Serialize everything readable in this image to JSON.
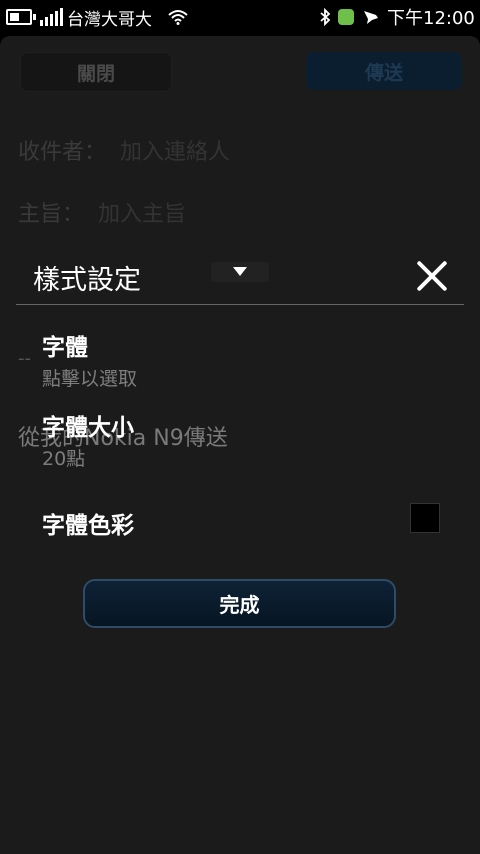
{
  "status_bar": {
    "carrier": "台灣大哥大",
    "time": "下午12:00",
    "icons": [
      "battery-icon",
      "signal-icon",
      "wifi-icon",
      "bluetooth-icon",
      "app-notification-icon",
      "chat-icon"
    ]
  },
  "compose": {
    "close_label": "關閉",
    "send_label": "傳送",
    "to_label": "收件者：",
    "to_placeholder": "加入連絡人",
    "subject_label": "主旨：",
    "subject_placeholder": "加入主旨",
    "signature_dash": "--",
    "signature": "從我的Nokia N9傳送"
  },
  "dialog": {
    "title": "樣式設定",
    "options": [
      {
        "label": "字體",
        "value": "點擊以選取"
      },
      {
        "label": "字體大小",
        "value": "20點"
      },
      {
        "label": "字體色彩",
        "color": "#000000"
      }
    ],
    "done_label": "完成"
  }
}
